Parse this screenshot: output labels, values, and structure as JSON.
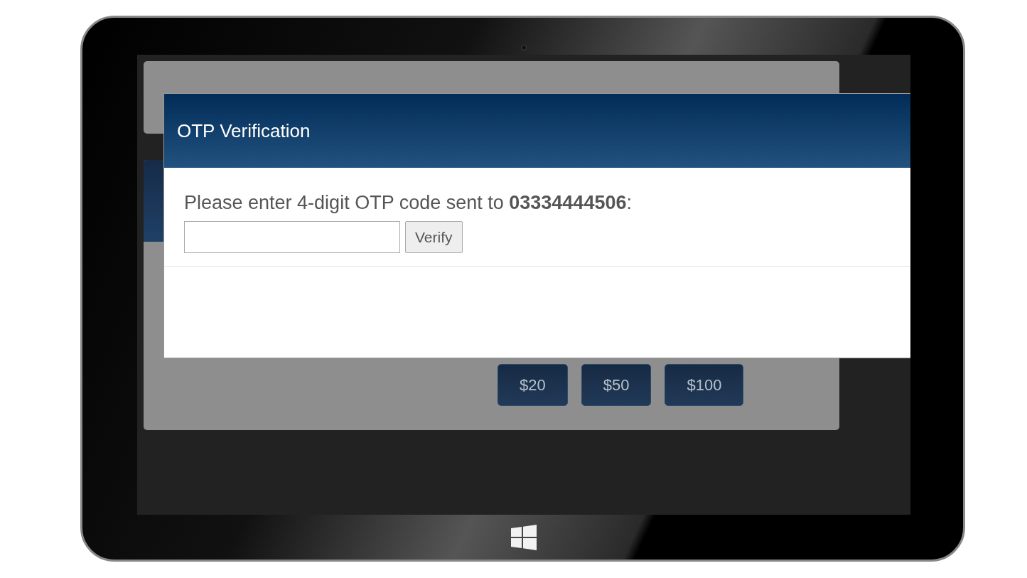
{
  "background_page": {
    "amount_buttons": [
      {
        "label": "$20"
      },
      {
        "label": "$50"
      },
      {
        "label": "$100"
      }
    ]
  },
  "dialog": {
    "title": "OTP Verification",
    "message": "Please enter 4-digit OTP code sent to **03334444506**:",
    "verify_button": "Verify"
  }
}
